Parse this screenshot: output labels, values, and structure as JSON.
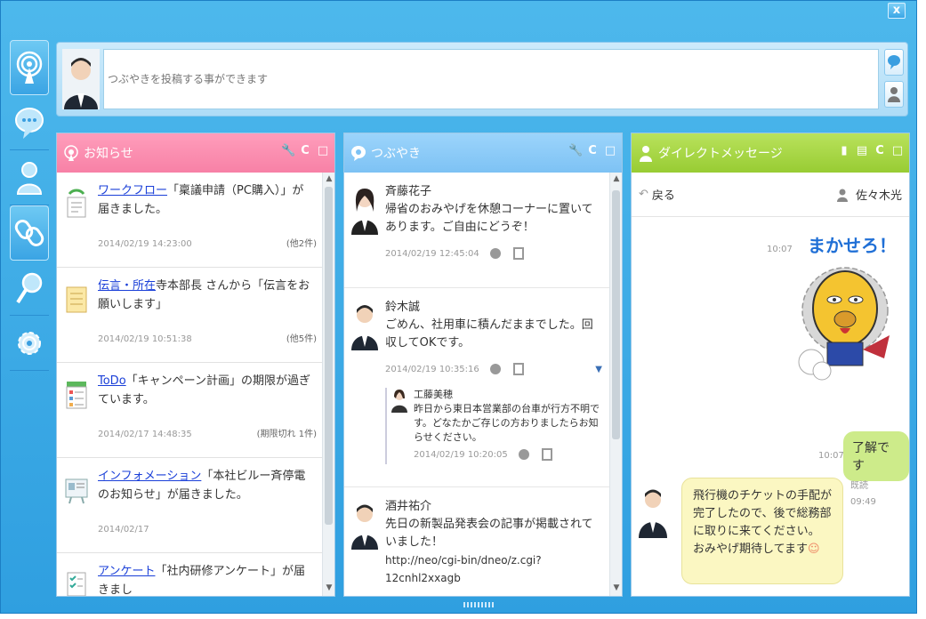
{
  "post": {
    "placeholder": "つぶやきを投稿する事ができます"
  },
  "close_label": "x",
  "notices_panel": {
    "title": "お知らせ",
    "items": [
      {
        "link": "ワークフロー",
        "text": "「稟議申請（PC購入）」が届きました。",
        "date": "2014/02/19 14:23:00",
        "count": "(他2件)"
      },
      {
        "link": "伝言・所在",
        "text": "寺本部長 さんから「伝言をお願いします」",
        "date": "2014/02/19 10:51:38",
        "count": "(他5件)"
      },
      {
        "link": "ToDo",
        "text": "「キャンペーン計画」の期限が過ぎています。",
        "date": "2014/02/17 14:48:35",
        "count": "(期限切れ 1件)"
      },
      {
        "link": "インフォメーション",
        "text": "「本社ビルー斉停電のお知らせ」が届きました。",
        "date": "2014/02/17",
        "count": ""
      },
      {
        "link": "アンケート",
        "text": "「社内研修アンケート」が届きまし",
        "date": "",
        "count": ""
      }
    ]
  },
  "feed_panel": {
    "title": "つぶやき",
    "items": [
      {
        "name": "斉藤花子",
        "text": "帰省のおみやげを休憩コーナーに置いてあります。ご自由にどうぞ！",
        "date": "2014/02/19 12:45:04"
      },
      {
        "name": "鈴木誠",
        "text": "ごめん、社用車に積んだままでした。回収してOKです。",
        "date": "2014/02/19 10:35:16",
        "reply": {
          "name": "工藤美穂",
          "text": "昨日から東日本営業部の台車が行方不明です。どなたかご存じの方おりましたらお知らせください。",
          "date": "2014/02/19 10:20:05"
        }
      },
      {
        "name": "酒井祐介",
        "text": "先日の新製品発表会の記事が掲載されていました！",
        "link": "http://neo/cgi-bin/dneo/z.cgi?12cnhl2xxagb"
      }
    ]
  },
  "dm_panel": {
    "title": "ダイレクトメッセージ",
    "back": "戻る",
    "partner": "佐々木光",
    "messages": [
      {
        "time": "10:07",
        "sticker_text": "まかせろ！"
      },
      {
        "time": "10:07",
        "text": "了解です"
      },
      {
        "status": "既読",
        "time": "09:49",
        "text_lines": [
          "飛行機のチケットの手配が完了したので、後で総務部に取りに来てください。",
          "おみやげ期待してます"
        ]
      }
    ]
  }
}
